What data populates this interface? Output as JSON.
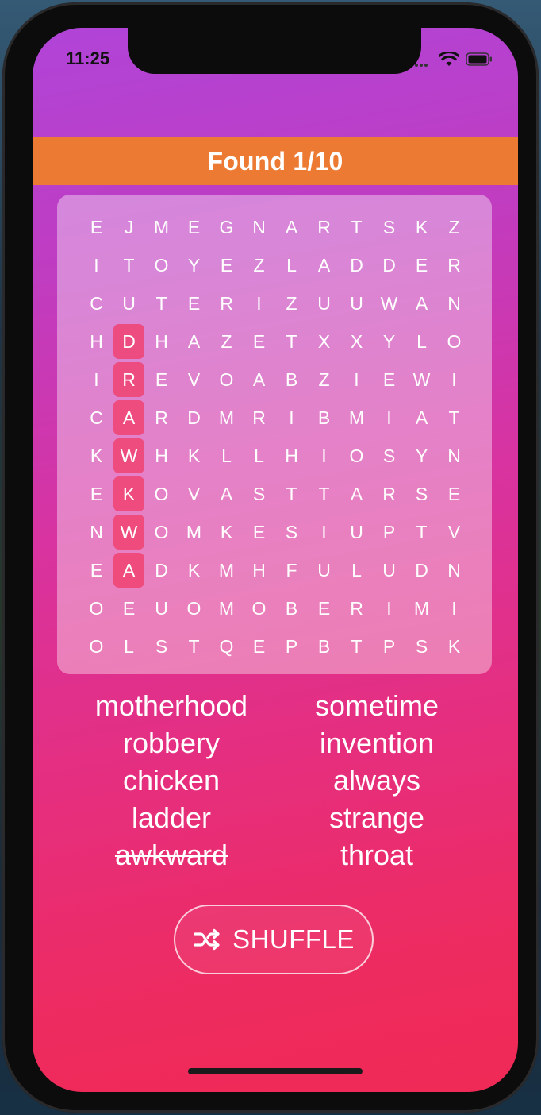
{
  "status_bar": {
    "time": "11:25"
  },
  "header": {
    "title": "Found 1/10",
    "color": "#ec7a32"
  },
  "grid": {
    "rows": [
      [
        "E",
        "J",
        "M",
        "E",
        "G",
        "N",
        "A",
        "R",
        "T",
        "S",
        "K",
        "Z"
      ],
      [
        "I",
        "T",
        "O",
        "Y",
        "E",
        "Z",
        "L",
        "A",
        "D",
        "D",
        "E",
        "R"
      ],
      [
        "C",
        "U",
        "T",
        "E",
        "R",
        "I",
        "Z",
        "U",
        "U",
        "W",
        "A",
        "N"
      ],
      [
        "H",
        "D",
        "H",
        "A",
        "Z",
        "E",
        "T",
        "X",
        "X",
        "Y",
        "L",
        "O"
      ],
      [
        "I",
        "R",
        "E",
        "V",
        "O",
        "A",
        "B",
        "Z",
        "I",
        "E",
        "W",
        "I"
      ],
      [
        "C",
        "A",
        "R",
        "D",
        "M",
        "R",
        "I",
        "B",
        "M",
        "I",
        "A",
        "T"
      ],
      [
        "K",
        "W",
        "H",
        "K",
        "L",
        "L",
        "H",
        "I",
        "O",
        "S",
        "Y",
        "N"
      ],
      [
        "E",
        "K",
        "O",
        "V",
        "A",
        "S",
        "T",
        "T",
        "A",
        "R",
        "S",
        "E"
      ],
      [
        "N",
        "W",
        "O",
        "M",
        "K",
        "E",
        "S",
        "I",
        "U",
        "P",
        "T",
        "V"
      ],
      [
        "E",
        "A",
        "D",
        "K",
        "M",
        "H",
        "F",
        "U",
        "L",
        "U",
        "D",
        "N"
      ],
      [
        "O",
        "E",
        "U",
        "O",
        "M",
        "O",
        "B",
        "E",
        "R",
        "I",
        "M",
        "I"
      ],
      [
        "O",
        "L",
        "S",
        "T",
        "Q",
        "E",
        "P",
        "B",
        "T",
        "P",
        "S",
        "K"
      ]
    ],
    "found_cells": [
      [
        3,
        1
      ],
      [
        4,
        1
      ],
      [
        5,
        1
      ],
      [
        6,
        1
      ],
      [
        7,
        1
      ],
      [
        8,
        1
      ],
      [
        9,
        1
      ]
    ],
    "highlight_color": "#f0406e"
  },
  "words": {
    "left": [
      {
        "text": "motherhood",
        "found": false
      },
      {
        "text": "robbery",
        "found": false
      },
      {
        "text": "chicken",
        "found": false
      },
      {
        "text": "ladder",
        "found": false
      },
      {
        "text": "awkward",
        "found": true
      }
    ],
    "right": [
      {
        "text": "sometime",
        "found": false
      },
      {
        "text": "invention",
        "found": false
      },
      {
        "text": "always",
        "found": false
      },
      {
        "text": "strange",
        "found": false
      },
      {
        "text": "throat",
        "found": false
      }
    ]
  },
  "shuffle": {
    "label": "SHUFFLE",
    "icon": "shuffle-icon"
  },
  "colors": {
    "gradient_top": "#b044d8",
    "gradient_bottom": "#f02a56"
  }
}
